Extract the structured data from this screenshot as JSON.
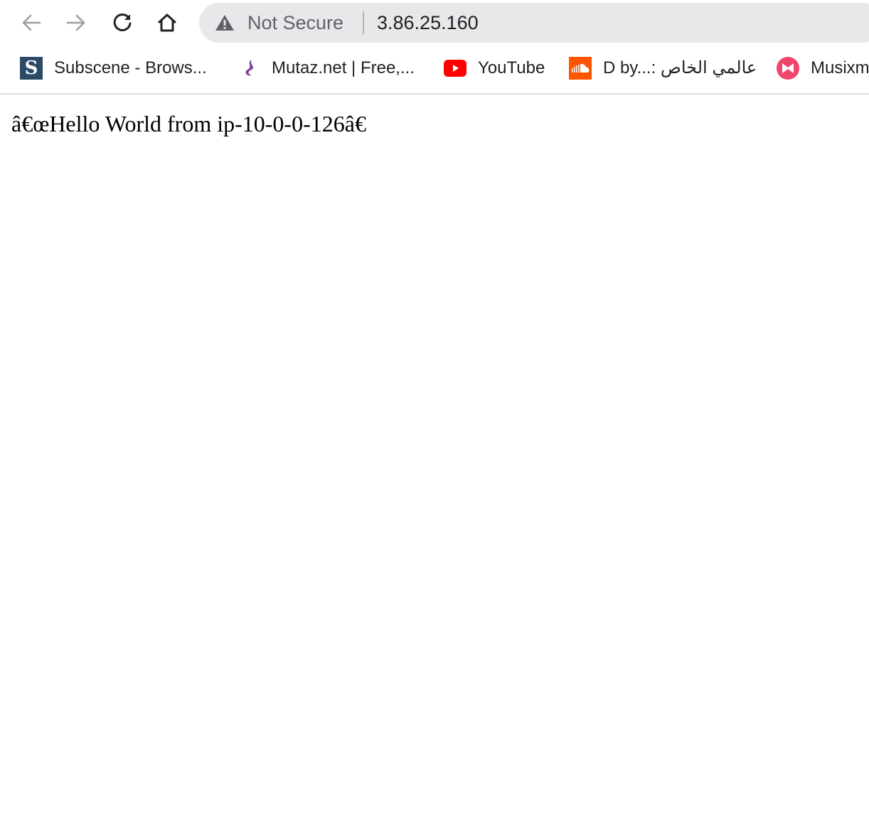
{
  "browser": {
    "nav": {
      "back_icon": "arrow-left-icon",
      "forward_icon": "arrow-right-icon",
      "reload_icon": "reload-icon",
      "home_icon": "home-icon"
    },
    "omnibox": {
      "security_icon": "warning-triangle-icon",
      "security_label": "Not Secure",
      "url": "3.86.25.160"
    },
    "bookmarks": [
      {
        "label": "Subscene - Brows...",
        "icon": "subscene-s-icon"
      },
      {
        "label": "Mutaz.net | Free,...",
        "icon": "mutaz-icon"
      },
      {
        "label": "YouTube",
        "icon": "youtube-icon"
      },
      {
        "label": "D by...: عالمي الخاص",
        "icon": "soundcloud-icon"
      },
      {
        "label": "Musixm",
        "icon": "musixmatch-icon"
      }
    ],
    "colors": {
      "omnibox_bg": "#e8e8ea",
      "youtube_red": "#ff0000",
      "soundcloud_orange": "#ff5500",
      "subscene_blue": "#2b4a66",
      "mutaz_purple": "#7b3f9e",
      "musixmatch_pink": "#f2436b"
    }
  },
  "page": {
    "body_text": "â€œHello World from ip-10-0-0-126â€"
  }
}
